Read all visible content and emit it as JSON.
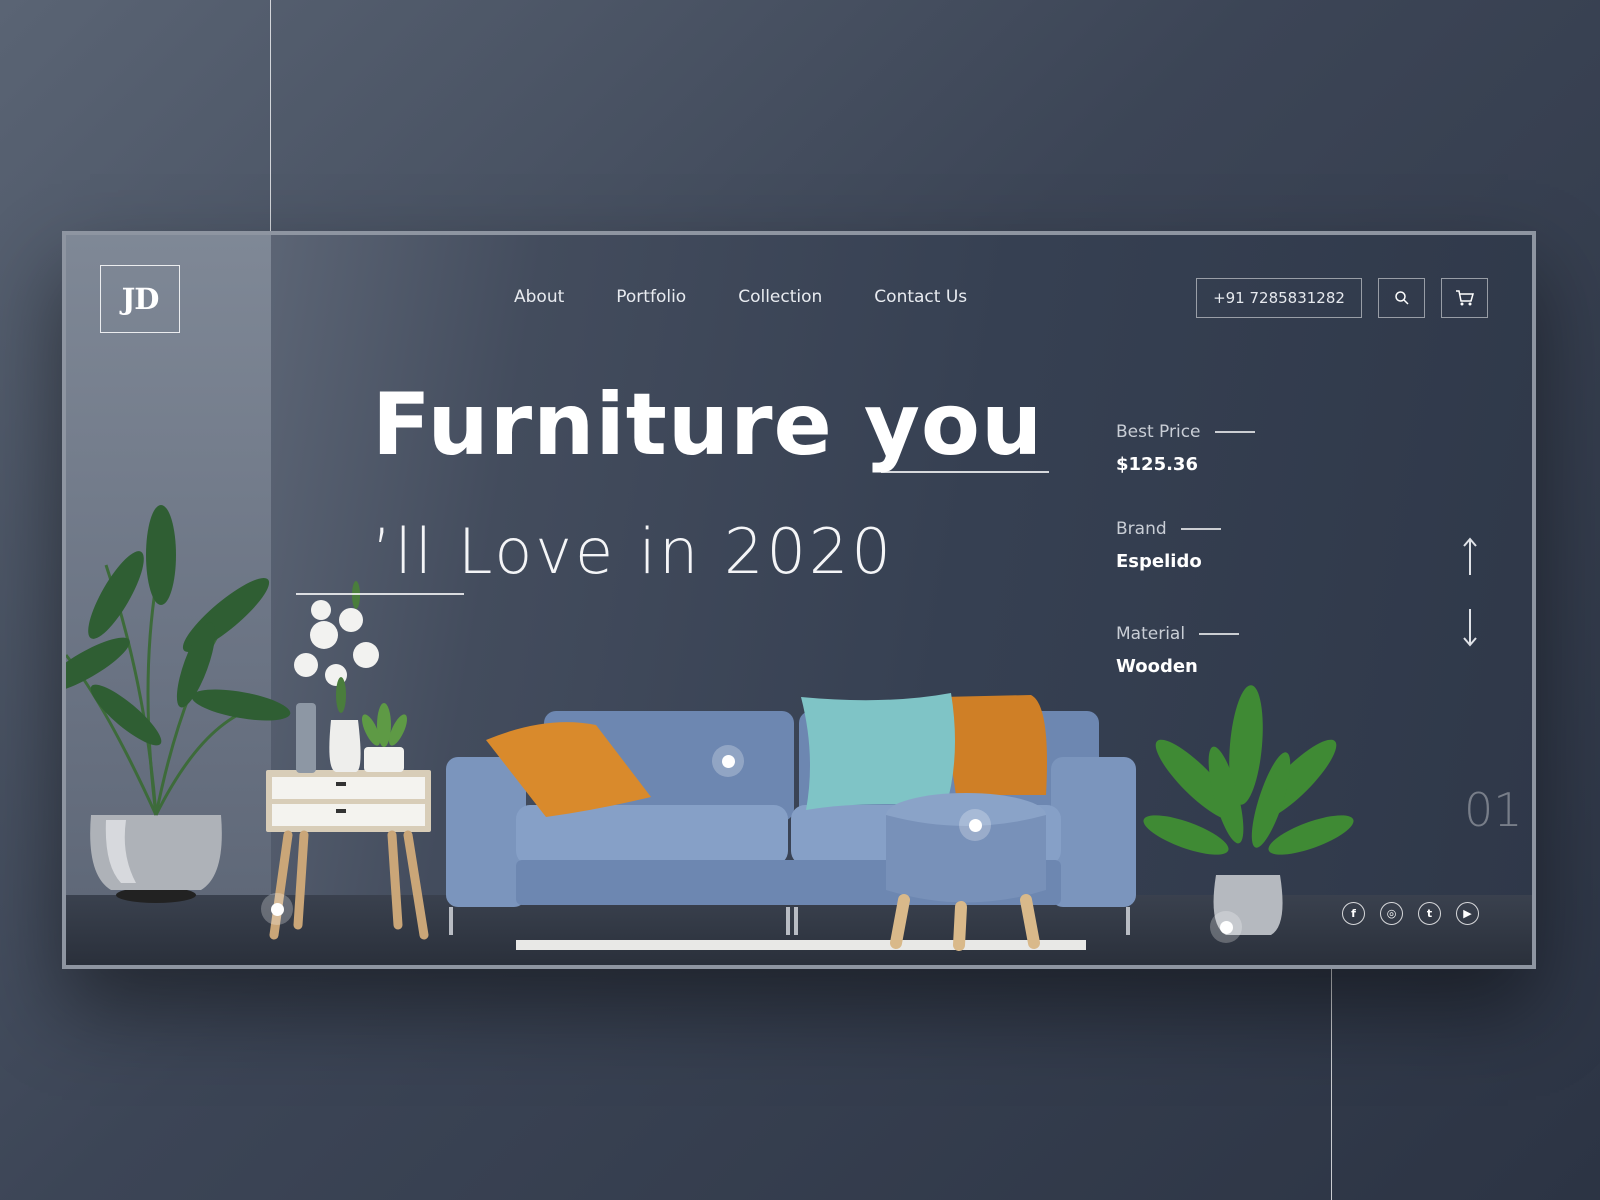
{
  "brand": {
    "logo_text": "JD"
  },
  "nav": {
    "items": [
      "About",
      "Portfolio",
      "Collection",
      "Contact Us"
    ]
  },
  "header": {
    "phone": "+91 7285831282",
    "search_icon": "search-icon",
    "cart_icon": "cart-icon"
  },
  "hero": {
    "line1": "Furniture you",
    "line2": "’ll Love in 2020"
  },
  "specs": [
    {
      "label": "Best Price",
      "value": "$125.36"
    },
    {
      "label": "Brand",
      "value": "Espelido"
    },
    {
      "label": "Material",
      "value": "Wooden"
    }
  ],
  "slider": {
    "number": "01",
    "prev_icon": "arrow-up-icon",
    "next_icon": "arrow-down-icon"
  },
  "social": [
    {
      "icon": "facebook-icon",
      "glyph": "f"
    },
    {
      "icon": "instagram-icon",
      "glyph": "◎"
    },
    {
      "icon": "twitter-icon",
      "glyph": "t"
    },
    {
      "icon": "youtube-icon",
      "glyph": "▶"
    }
  ],
  "colors": {
    "accent_orange": "#d98a2c",
    "sofa_blue": "#6f8bb5",
    "cushion_teal": "#7fc4c6"
  }
}
